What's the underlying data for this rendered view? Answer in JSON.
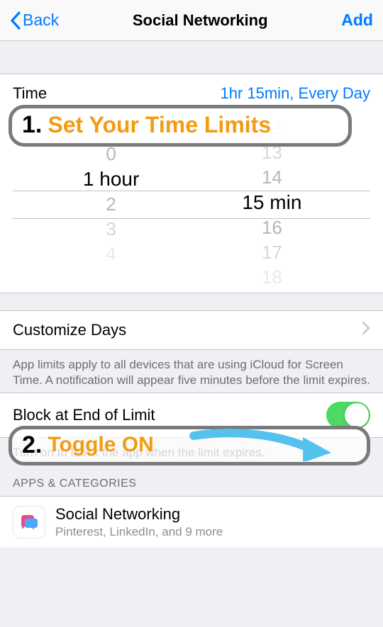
{
  "nav": {
    "back_label": "Back",
    "title": "Social Networking",
    "add_label": "Add"
  },
  "time_row": {
    "label": "Time",
    "value": "1hr 15min, Every Day"
  },
  "picker": {
    "hours": {
      "above2": "",
      "above1": "0",
      "selected": "1",
      "unit": "hour",
      "below1": "2",
      "below2": "3",
      "below3": "4"
    },
    "minutes": {
      "above3": "12",
      "above2": "13",
      "above1": "14",
      "selected": "15",
      "unit": "min",
      "below1": "16",
      "below2": "17",
      "below3": "18"
    }
  },
  "customize": {
    "label": "Customize Days"
  },
  "notes": {
    "app_limits": "App limits apply to all devices that are using iCloud for Screen Time. A notification will appear five minutes before the limit expires.",
    "block": "Turn on to block the app when the limit expires."
  },
  "block_row": {
    "label": "Block at End of Limit",
    "on": true
  },
  "sections": {
    "apps": "APPS & CATEGORIES"
  },
  "apps_row": {
    "title": "Social Networking",
    "subtitle": "Pinterest, LinkedIn, and 9 more"
  },
  "annotations": {
    "one_num": "1.",
    "one_text": "Set Your Time Limits",
    "two_num": "2.",
    "two_text": "Toggle ON"
  }
}
